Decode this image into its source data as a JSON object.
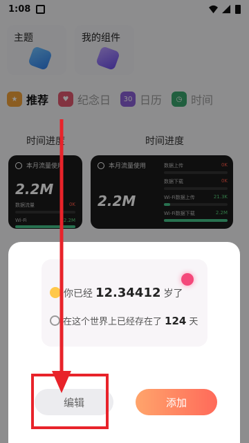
{
  "status_bar": {
    "time": "1:08"
  },
  "top_cards": [
    {
      "title": "主题"
    },
    {
      "title": "我的组件"
    }
  ],
  "tabs": [
    {
      "label": "推荐",
      "active": true,
      "icon": "star-icon"
    },
    {
      "label": "纪念日",
      "active": false,
      "icon": "heart-icon"
    },
    {
      "label": "日历",
      "active": false,
      "icon": "calendar-icon",
      "badge": "30"
    },
    {
      "label": "时间",
      "active": false,
      "icon": "clock-icon"
    }
  ],
  "sections": {
    "left_title": "时间进度",
    "right_title": "时间进度"
  },
  "widget_small": {
    "header": "本月流量使用",
    "big": "2.2M",
    "rows": [
      {
        "label": "数据流量",
        "value": "0K"
      },
      {
        "label": "Wi-Fi",
        "value": "2.2M"
      }
    ]
  },
  "widget_large": {
    "header": "本月流量使用",
    "big": "2.2M",
    "rows": [
      {
        "label": "数据上传",
        "value": "0K"
      },
      {
        "label": "数据下载",
        "value": "0K"
      },
      {
        "label": "Wi-Fi数据上传",
        "value": "21.3K"
      },
      {
        "label": "Wi-Fi数据下载",
        "value": "2.2M"
      }
    ],
    "bar_levels": [
      0.0,
      0.0,
      0.1,
      1.0
    ]
  },
  "dialog": {
    "line1_prefix": "你已经",
    "age_value": "12.34412",
    "line1_suffix": "岁了",
    "line2_prefix": "在这个世界上已经存在了",
    "days_value": "124",
    "line2_suffix": "天",
    "edit_label": "编辑",
    "add_label": "添加"
  },
  "colors": {
    "accent": "#e8232a",
    "add_button": "#ff7a5e"
  }
}
